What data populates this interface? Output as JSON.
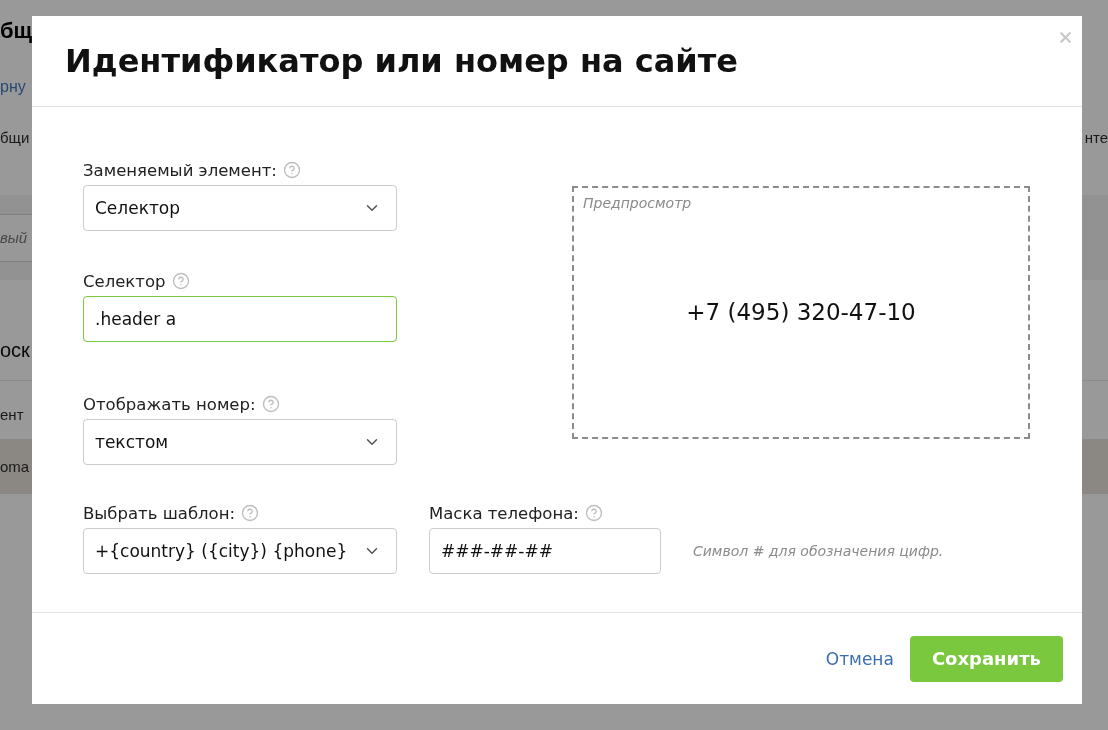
{
  "background": {
    "rows": [
      {
        "kind": "heading",
        "text": "бщ"
      },
      {
        "kind": "link",
        "text": "рну"
      },
      {
        "kind": "text",
        "text": "бщи",
        "right_text": "нте"
      },
      {
        "kind": "field",
        "placeholder": "вый"
      },
      {
        "kind": "subheading",
        "text": "оск"
      },
      {
        "kind": "text",
        "text": "ент"
      },
      {
        "kind": "highlight",
        "text": "oma"
      }
    ]
  },
  "dialog": {
    "title": "Идентификатор или номер на сайте",
    "fields": [
      {
        "kind": "select",
        "label": "Заменяемый элемент:",
        "help": true,
        "value": "Селектор",
        "focused": false
      },
      {
        "kind": "input",
        "label": "Селектор",
        "help": true,
        "value": ".header a",
        "focused": true
      },
      {
        "kind": "select",
        "label": "Отображать номер:",
        "help": true,
        "value": "текстом",
        "focused": false
      }
    ],
    "preview": {
      "caption": "Предпросмотр",
      "phone": "+7 (495) 320-47-10"
    },
    "bottom_fields": [
      {
        "kind": "select",
        "label": "Выбрать шаблон:",
        "help": true,
        "value": "+{country} ({city}) {phone}",
        "focused": false
      },
      {
        "kind": "input",
        "label": "Маска телефона:",
        "help": true,
        "value": "###-##-##",
        "focused": false
      }
    ],
    "mask_hint": "Символ # для обозначения цифр.",
    "buttons": [
      {
        "kind": "link",
        "label": "Отмена"
      },
      {
        "kind": "primary",
        "label": "Сохранить"
      }
    ]
  }
}
